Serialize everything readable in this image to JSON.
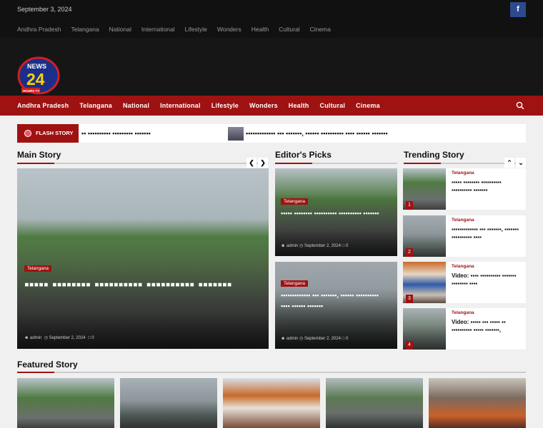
{
  "topbar": {
    "date": "September 3, 2024",
    "social": "f",
    "nav": [
      "Andhra Pradesh",
      "Telangana",
      "National",
      "International",
      "Lifestyle",
      "Wonders",
      "Health",
      "Cultural",
      "Cinema"
    ]
  },
  "logo": {
    "main": "NEWS",
    "num": "24",
    "sub": "HOURS TV"
  },
  "mainnav": [
    "Andhra Pradesh",
    "Telangana",
    "National",
    "International",
    "Lifestyle",
    "Wonders",
    "Health",
    "Cultural",
    "Cinema"
  ],
  "ticker": {
    "label": "FLASH STORY",
    "item1": "▪▪ ▪▪▪▪▪▪▪▪▪▪ ▪▪▪▪▪▪▪▪▪ ▪▪▪▪▪▪▪",
    "item2": "▪▪▪▪▪▪▪▪▪▪▪▪▪ ▪▪▪ ▪▪▪▪▪▪▪, ▪▪▪▪▪▪ ▪▪▪▪▪▪▪▪▪▪ ▪▪▪▪ ▪▪▪▪▪▪ ▪▪▪▪▪▪▪"
  },
  "sections": {
    "main": "Main Story",
    "editor": "Editor's Picks",
    "trending": "Trending Story",
    "featured": "Featured Story"
  },
  "main_story": {
    "category": "Telangana",
    "title": "▪▪▪▪▪ ▪▪▪▪▪▪▪▪ ▪▪▪▪▪▪▪▪▪▪ ▪▪▪▪▪▪▪▪▪▪ ▪▪▪▪▪▪▪",
    "author": "admin",
    "date": "September 2, 2024",
    "comments": "0"
  },
  "editor_picks": [
    {
      "category": "Telangana",
      "title": "▪▪▪▪▪ ▪▪▪▪▪▪▪▪ ▪▪▪▪▪▪▪▪▪▪ ▪▪▪▪▪▪▪▪▪▪ ▪▪▪▪▪▪▪",
      "author": "admin",
      "date": "September 2, 2024",
      "comments": "0"
    },
    {
      "category": "Telangana",
      "title": "▪▪▪▪▪▪▪▪▪▪▪▪▪ ▪▪▪ ▪▪▪▪▪▪▪, ▪▪▪▪▪▪ ▪▪▪▪▪▪▪▪▪▪ ▪▪▪▪ ▪▪▪▪▪▪ ▪▪▪▪▪▪▪",
      "author": "admin",
      "date": "September 2, 2024",
      "comments": "0"
    }
  ],
  "trending": [
    {
      "n": "1",
      "category": "Telangana",
      "title": "▪▪▪▪▪ ▪▪▪▪▪▪▪▪ ▪▪▪▪▪▪▪▪▪▪ ▪▪▪▪▪▪▪▪▪▪ ▪▪▪▪▪▪▪"
    },
    {
      "n": "2",
      "category": "Telangana",
      "title": "▪▪▪▪▪▪▪▪▪▪▪▪▪ ▪▪▪ ▪▪▪▪▪▪▪, ▪▪▪▪▪▪▪ ▪▪▪▪▪▪▪▪▪▪ ▪▪▪▪"
    },
    {
      "n": "3",
      "category": "Telangana",
      "title": "Video: ▪▪▪▪ ▪▪▪▪▪▪▪▪▪▪ ▪▪▪▪▪▪▪ ▪▪▪▪▪▪▪▪ ▪▪▪▪"
    },
    {
      "n": "4",
      "category": "Telangana",
      "title": "Video: ▪▪▪▪▪ ▪▪▪ ▪▪▪▪▪ ▪▪ ▪▪▪▪▪▪▪▪▪▪ ▪▪▪▪▪ ▪▪▪▪▪▪▪,"
    }
  ],
  "colors": {
    "accent": "#9f1212",
    "topbar": "#111111",
    "header": "#161616"
  },
  "icons": {
    "prev": "chevron-left",
    "next": "chevron-right",
    "up": "chevron-up",
    "down": "chevron-down",
    "search": "search-icon"
  }
}
